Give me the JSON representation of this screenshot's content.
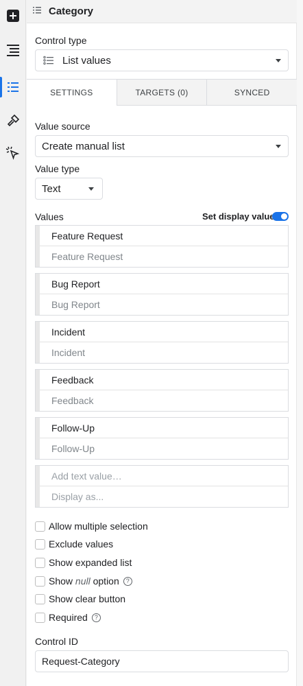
{
  "header": {
    "title": "Category"
  },
  "control_type": {
    "label": "Control type",
    "value": "List values"
  },
  "tabs": [
    {
      "label": "SETTINGS"
    },
    {
      "label": "TARGETS (0)"
    },
    {
      "label": "SYNCED"
    }
  ],
  "value_source": {
    "label": "Value source",
    "value": "Create manual list"
  },
  "value_type": {
    "label": "Value type",
    "value": "Text"
  },
  "values": {
    "label": "Values",
    "set_display_label": "Set display values",
    "set_display_enabled": true,
    "items": [
      {
        "value": "Feature Request",
        "display": "Feature Request"
      },
      {
        "value": "Bug Report",
        "display": "Bug Report"
      },
      {
        "value": "Incident",
        "display": "Incident"
      },
      {
        "value": "Feedback",
        "display": "Feedback"
      },
      {
        "value": "Follow-Up",
        "display": "Follow-Up"
      }
    ],
    "new_value_placeholder": "Add text value…",
    "new_display_placeholder": "Display as..."
  },
  "options": {
    "allow_multiple": "Allow multiple selection",
    "exclude_values": "Exclude values",
    "show_expanded": "Show expanded list",
    "show_null_prefix": "Show",
    "show_null_word": "null",
    "show_null_suffix": "option",
    "show_clear": "Show clear button",
    "required": "Required",
    "help_glyph": "?"
  },
  "control_id": {
    "label": "Control ID",
    "value": "Request-Category"
  },
  "colors": {
    "accent": "#1a73e8"
  }
}
